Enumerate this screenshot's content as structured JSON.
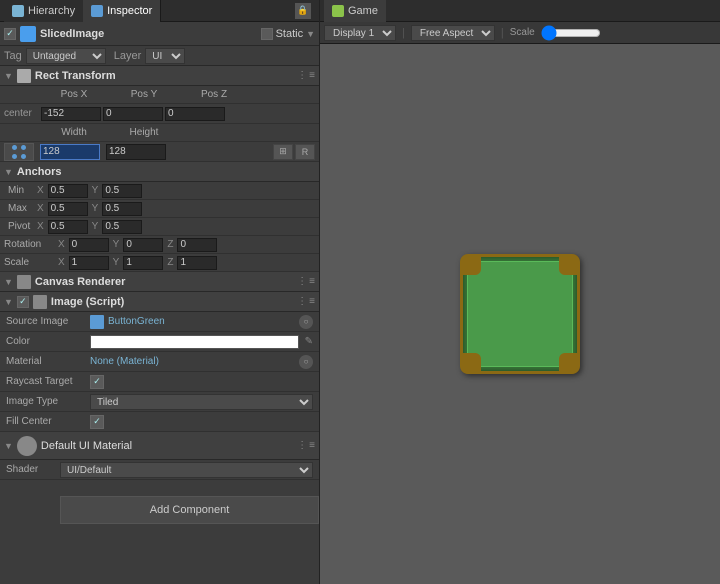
{
  "tabs": {
    "hierarchy": "Hierarchy",
    "inspector": "Inspector"
  },
  "header": {
    "component_name": "SlicedImage",
    "static_label": "Static",
    "tag_label": "Tag",
    "tag_value": "Untagged",
    "layer_label": "Layer",
    "layer_value": "UI"
  },
  "rect_transform": {
    "title": "Rect Transform",
    "center_label": "center",
    "pos_x_label": "Pos X",
    "pos_x_value": "-152",
    "pos_y_label": "Pos Y",
    "pos_y_value": "0",
    "pos_z_label": "Pos Z",
    "pos_z_value": "0",
    "width_label": "Width",
    "width_value": "128",
    "height_label": "Height",
    "height_value": "128",
    "r_btn": "R"
  },
  "anchors": {
    "title": "Anchors",
    "min_label": "Min",
    "min_x": "0.5",
    "min_y": "0.5",
    "max_label": "Max",
    "max_x": "0.5",
    "max_y": "0.5",
    "pivot_label": "Pivot",
    "pivot_x": "0.5",
    "pivot_y": "0.5"
  },
  "rotation": {
    "label": "Rotation",
    "x": "0",
    "y": "0",
    "z": "0"
  },
  "scale": {
    "label": "Scale",
    "x": "1",
    "y": "1",
    "z": "1"
  },
  "canvas_renderer": {
    "title": "Canvas Renderer"
  },
  "image_script": {
    "title": "Image (Script)",
    "source_label": "Source Image",
    "source_value": "ButtonGreen",
    "color_label": "Color",
    "material_label": "Material",
    "material_value": "None (Material)",
    "raycast_label": "Raycast Target",
    "image_type_label": "Image Type",
    "image_type_value": "Tiled",
    "fill_center_label": "Fill Center"
  },
  "default_material": {
    "title": "Default UI Material",
    "shader_label": "Shader",
    "shader_value": "UI/Default"
  },
  "add_component": {
    "label": "Add Component"
  },
  "game": {
    "tab_label": "Game",
    "display_label": "Display 1",
    "aspect_label": "Free Aspect",
    "scale_label": "Scale"
  }
}
